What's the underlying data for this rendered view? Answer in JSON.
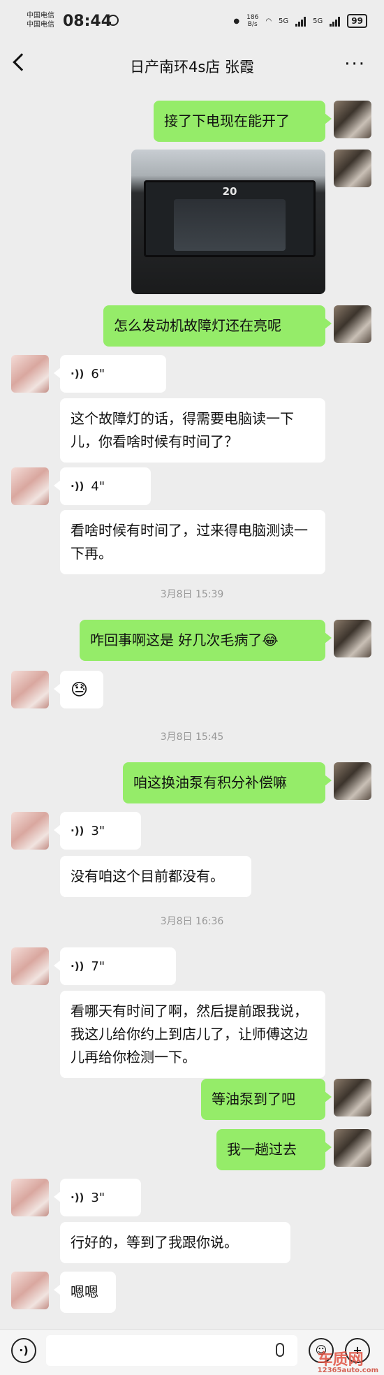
{
  "status_bar": {
    "carrier_1": "中国电信",
    "carrier_2": "中国电信",
    "time": "08:44",
    "net_speed": "186",
    "net_unit": "B/s",
    "network_1": "5G",
    "network_2": "5G",
    "battery": "99"
  },
  "header": {
    "title": "日产南环4s店 张霞"
  },
  "messages": {
    "m1": "接了下电现在能开了",
    "photo_speed": "20",
    "m3": "怎么发动机故障灯还在亮呢",
    "voice1": "6\"",
    "m5": "这个故障灯的话，得需要电脑读一下儿，你看啥时候有时间了？",
    "voice2": "4\"",
    "m7": "看啥时候有时间了，过来得电脑测读一下再。",
    "time1": "3月8日 15:39",
    "m8": "咋回事啊这是 好几次毛病了😂",
    "m9": "😓",
    "time2": "3月8日 15:45",
    "m10": "咱这换油泵有积分补偿嘛",
    "voice3": "3\"",
    "m12": "没有咱这个目前都没有。",
    "time3": "3月8日 16:36",
    "voice4": "7\"",
    "m14": "看哪天有时间了啊，然后提前跟我说，我这儿给你约上到店儿了，让师傅这边儿再给你检测一下。",
    "m15": "等油泵到了吧",
    "m16": "我一趟过去",
    "voice5": "3\"",
    "m18": "行好的，等到了我跟你说。",
    "m19": "嗯嗯"
  },
  "watermark": {
    "brand": "车质网",
    "site": "12365auto.com"
  }
}
